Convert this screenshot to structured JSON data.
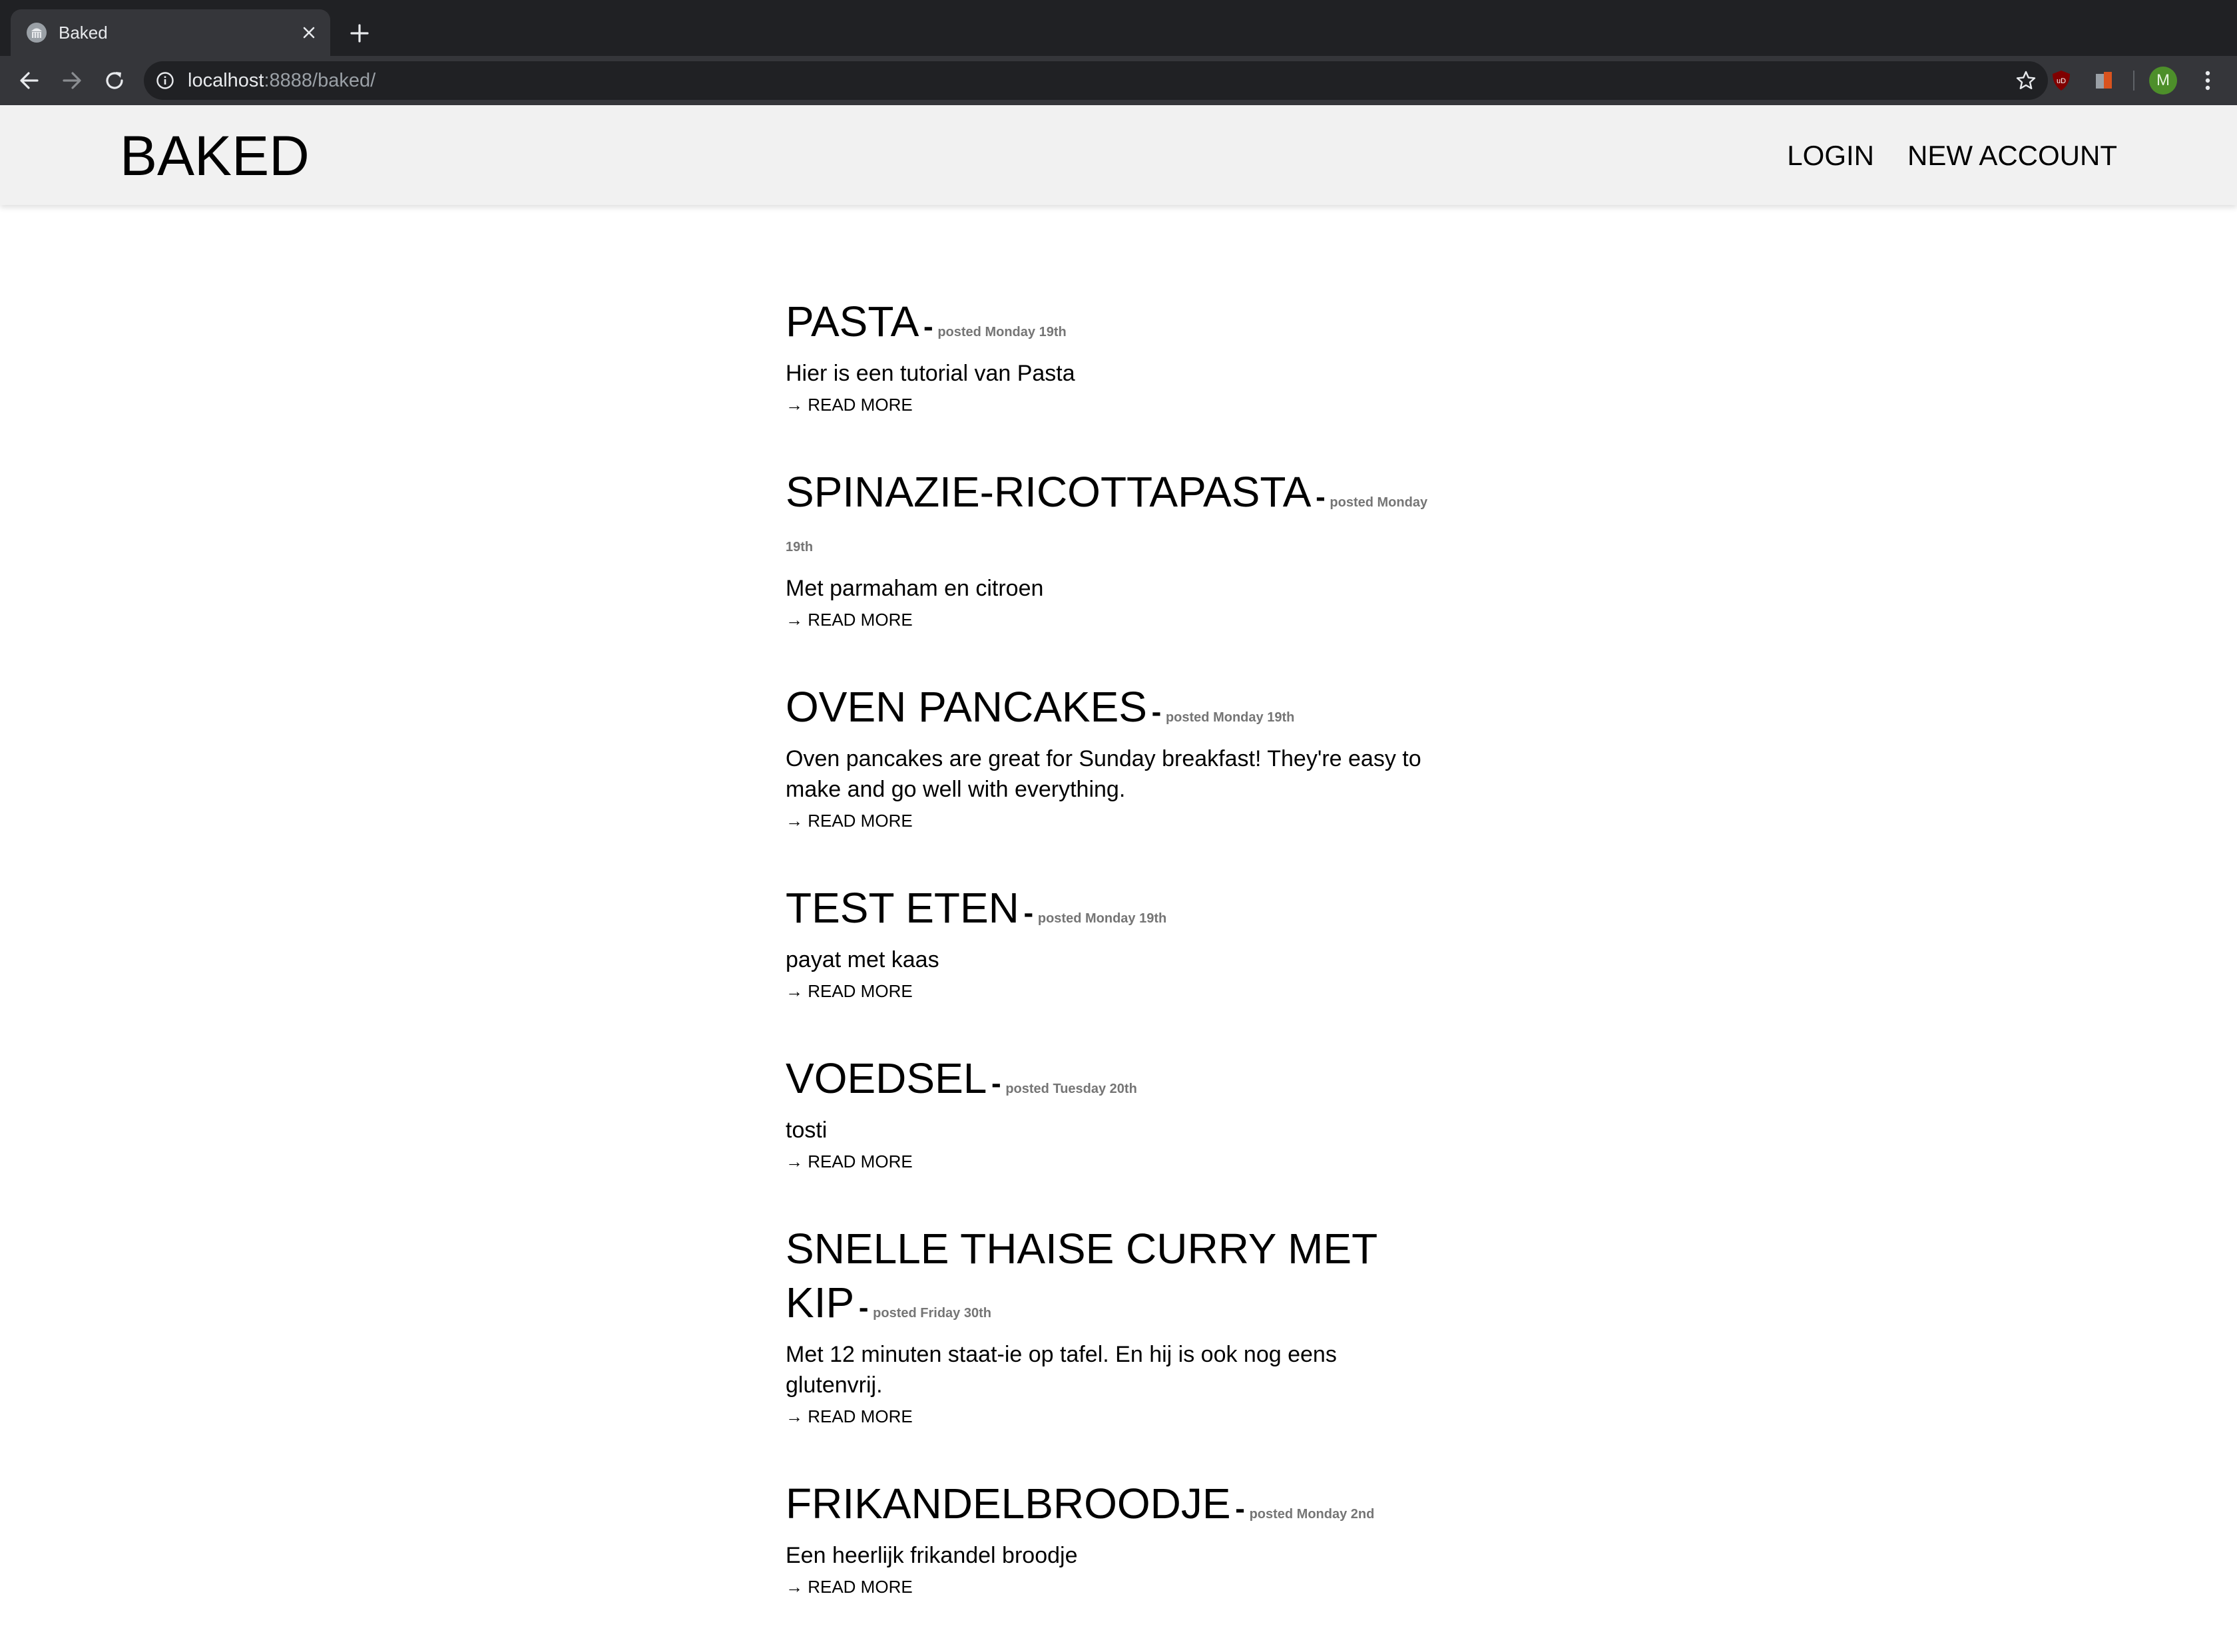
{
  "browser": {
    "tab_title": "Baked",
    "url_host": "localhost",
    "url_rest": ":8888/baked/",
    "profile_initial": "M"
  },
  "site": {
    "brand": "BAKED",
    "nav": {
      "login": "LOGIN",
      "new_account": "NEW ACCOUNT"
    }
  },
  "posts": [
    {
      "title": "PASTA",
      "sep": "-",
      "date": "posted Monday 19th",
      "excerpt": "Hier is een tutorial van Pasta",
      "read_more": "→ READ MORE"
    },
    {
      "title": "SPINAZIE-RICOTTAPASTA",
      "sep": "-",
      "date": "posted Monday 19th",
      "excerpt": "Met parmaham en citroen",
      "read_more": "→ READ MORE"
    },
    {
      "title": "OVEN PANCAKES",
      "sep": "-",
      "date": "posted Monday 19th",
      "excerpt": "Oven pancakes are great for Sunday breakfast! They're easy to make and go well with everything.",
      "read_more": "→ READ MORE"
    },
    {
      "title": "TEST ETEN",
      "sep": "-",
      "date": "posted Monday 19th",
      "excerpt": "payat met kaas",
      "read_more": "→ READ MORE"
    },
    {
      "title": "VOEDSEL",
      "sep": "-",
      "date": "posted Tuesday 20th",
      "excerpt": "tosti",
      "read_more": "→ READ MORE"
    },
    {
      "title": "SNELLE THAISE CURRY MET KIP",
      "sep": "-",
      "date": "posted Friday 30th",
      "excerpt": "Met 12 minuten staat-ie op tafel. En hij is ook nog eens glutenvrij.",
      "read_more": "→ READ MORE"
    },
    {
      "title": "FRIKANDELBROODJE",
      "sep": "-",
      "date": "posted Monday 2nd",
      "excerpt": "Een heerlijk frikandel broodje",
      "read_more": "→ READ MORE"
    }
  ]
}
